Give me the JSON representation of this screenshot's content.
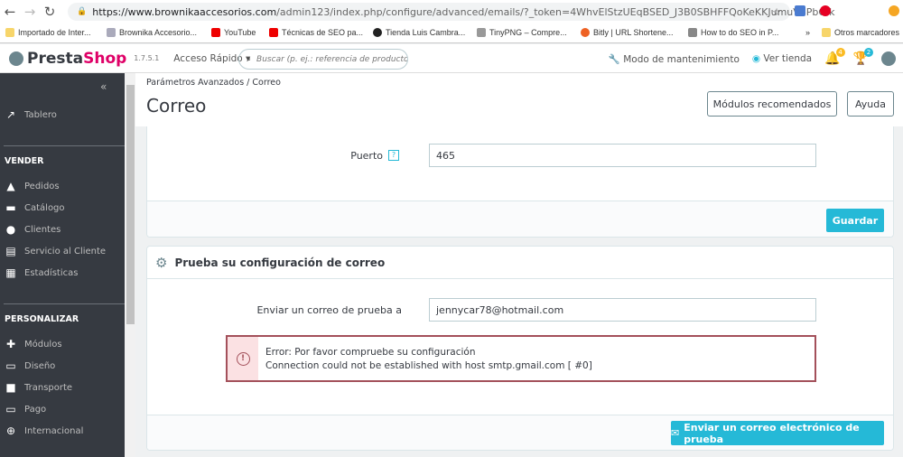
{
  "browser": {
    "url_host": "https://www.brownikaaccesorios.com",
    "url_path": "/admin123/index.php/configure/advanced/emails/?_token=4WhvElStzUEqBSED_J3B0SBHFFQoKeKKJumuVSPbOik",
    "bookmarks": [
      "Importado de Inter...",
      "Brownika Accesorio...",
      "YouTube",
      "Técnicas de SEO pa...",
      "Tienda Luis Cambra...",
      "TinyPNG – Compre...",
      "Bitly | URL Shortene...",
      "How to do SEO in P...",
      "»",
      "Otros marcadores"
    ]
  },
  "header": {
    "brand_a": "Presta",
    "brand_b": "Shop",
    "version": "1.7.5.1",
    "quick_access": "Acceso Rápido ▾",
    "search_placeholder": "Buscar (p. ej.: referencia de producto, nombre de cliente…)",
    "maintenance": "Modo de mantenimiento",
    "view_store": "Ver tienda",
    "notif_count": "4",
    "trophy_count": "2"
  },
  "sidebar": {
    "collapse": "«",
    "dashboard": "Tablero",
    "sell_title": "VENDER",
    "sell": [
      "Pedidos",
      "Catálogo",
      "Clientes",
      "Servicio al Cliente",
      "Estadísticas"
    ],
    "custom_title": "PERSONALIZAR",
    "custom": [
      "Módulos",
      "Diseño",
      "Transporte",
      "Pago",
      "Internacional"
    ]
  },
  "page": {
    "breadcrumb": "Parámetros Avanzados  /  Correo",
    "title": "Correo",
    "recommended": "Módulos recomendados",
    "help": "Ayuda"
  },
  "smtp": {
    "port_label": "Puerto",
    "port_help": "?",
    "port_value": "465",
    "save": "Guardar"
  },
  "test": {
    "title": "Prueba su configuración de correo",
    "send_label": "Enviar un correo de prueba a",
    "send_value": "jennycar78@hotmail.com",
    "error_line1": "Error: Por favor compruebe su configuración",
    "error_line2": "Connection could not be established with host smtp.gmail.com [ #0]",
    "send_button": "Enviar un correo electrónico de prueba"
  }
}
